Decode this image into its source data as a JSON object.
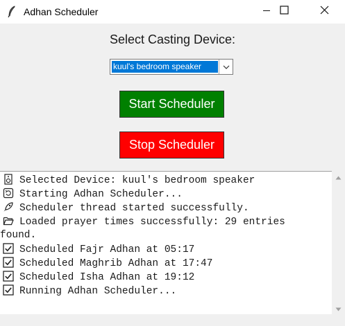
{
  "window": {
    "title": "Adhan Scheduler"
  },
  "controls": {
    "select_label": "Select Casting Device:",
    "device_value": "kuul's bedroom speaker",
    "start_button": "Start Scheduler",
    "stop_button": "Stop Scheduler"
  },
  "colors": {
    "start": "#008000",
    "stop": "#ff0000",
    "selection": "#0078d7"
  },
  "log": {
    "lines": [
      {
        "icon": "speaker-icon",
        "text": "Selected Device: kuul's bedroom speaker"
      },
      {
        "icon": "refresh-icon",
        "text": "Starting Adhan Scheduler..."
      },
      {
        "icon": "rocket-icon",
        "text": "Scheduler thread started successfully."
      },
      {
        "icon": "folder-icon",
        "text": "Loaded prayer times successfully: 29 entries"
      },
      {
        "icon": "",
        "text": "found."
      },
      {
        "icon": "checkbox-icon",
        "text": "Scheduled Fajr Adhan at 05:17"
      },
      {
        "icon": "checkbox-icon",
        "text": "Scheduled Maghrib Adhan at 17:47"
      },
      {
        "icon": "checkbox-icon",
        "text": "Scheduled Isha Adhan at 19:12"
      },
      {
        "icon": "checkbox-icon",
        "text": "Running Adhan Scheduler..."
      }
    ]
  }
}
